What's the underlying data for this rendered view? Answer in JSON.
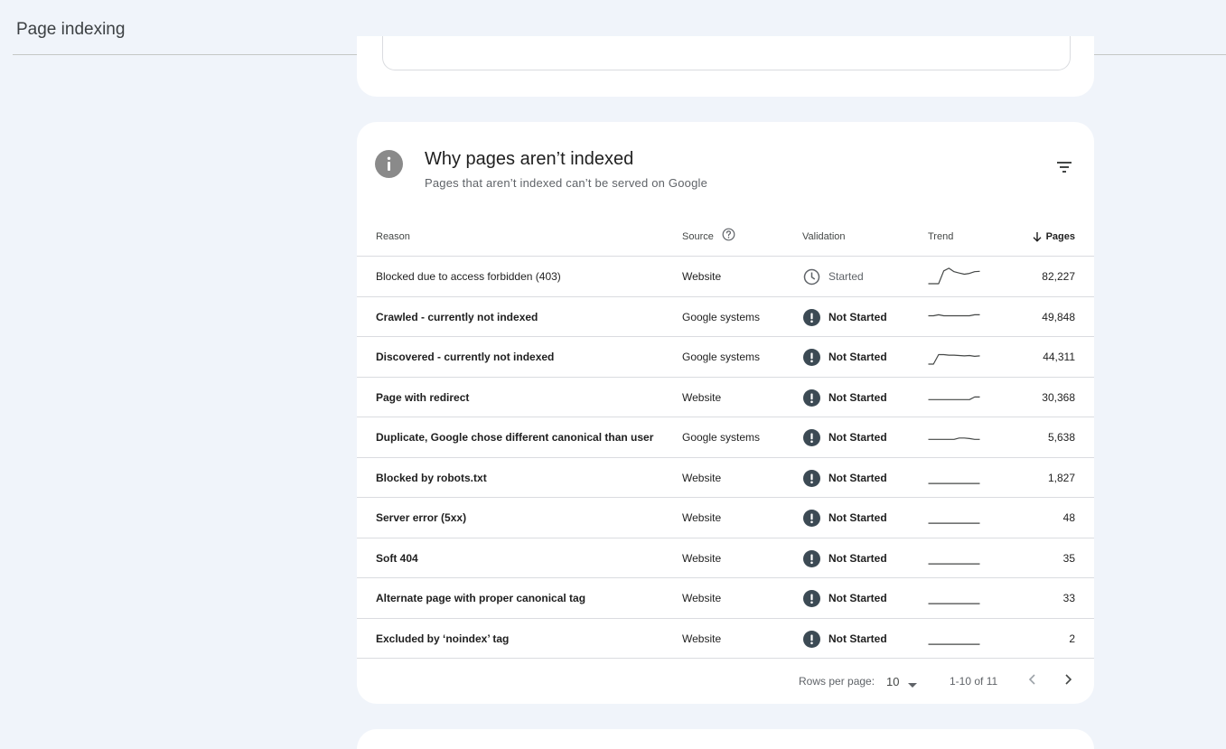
{
  "header": {
    "title": "Page indexing"
  },
  "card": {
    "title": "Why pages aren’t indexed",
    "subtitle": "Pages that aren’t indexed can’t be served on Google",
    "icon": "info-icon",
    "filter_icon": "filter-icon"
  },
  "table": {
    "columns": {
      "reason": "Reason",
      "source": "Source",
      "validation": "Validation",
      "trend": "Trend",
      "pages": "Pages"
    },
    "sort": {
      "column": "pages",
      "direction": "descending"
    },
    "rows": [
      {
        "reason": "Blocked due to access forbidden (403)",
        "source": "Website",
        "validation": "Started",
        "validation_icon": "clock-icon",
        "trend": [
          0,
          0,
          0,
          0.75,
          0.9,
          0.7,
          0.62,
          0.55,
          0.6,
          0.7,
          0.72
        ],
        "pages": "82,227"
      },
      {
        "reason": "Crawled - currently not indexed",
        "source": "Google systems",
        "validation": "Not Started",
        "validation_icon": "exclamation-icon",
        "trend": [
          0.5,
          0.5,
          0.56,
          0.5,
          0.5,
          0.5,
          0.5,
          0.5,
          0.5,
          0.56,
          0.56
        ],
        "pages": "49,848"
      },
      {
        "reason": "Discovered - currently not indexed",
        "source": "Google systems",
        "validation": "Not Started",
        "validation_icon": "exclamation-icon",
        "trend": [
          0,
          0,
          0.55,
          0.55,
          0.52,
          0.52,
          0.5,
          0.48,
          0.5,
          0.45,
          0.48
        ],
        "pages": "44,311"
      },
      {
        "reason": "Page with redirect",
        "source": "Website",
        "validation": "Not Started",
        "validation_icon": "exclamation-icon",
        "trend": [
          0.3,
          0.3,
          0.3,
          0.3,
          0.3,
          0.3,
          0.3,
          0.3,
          0.3,
          0.45,
          0.45
        ],
        "pages": "30,368"
      },
      {
        "reason": "Duplicate, Google chose different canonical than user",
        "source": "Google systems",
        "validation": "Not Started",
        "validation_icon": "exclamation-icon",
        "trend": [
          0.3,
          0.3,
          0.3,
          0.3,
          0.3,
          0.3,
          0.38,
          0.38,
          0.35,
          0.3,
          0.3
        ],
        "pages": "5,638"
      },
      {
        "reason": "Blocked by robots.txt",
        "source": "Website",
        "validation": "Not Started",
        "validation_icon": "exclamation-icon",
        "trend": [
          0.1,
          0.1,
          0.1,
          0.1,
          0.1,
          0.1,
          0.1,
          0.1,
          0.1,
          0.1,
          0.1
        ],
        "pages": "1,827"
      },
      {
        "reason": "Server error (5xx)",
        "source": "Website",
        "validation": "Not Started",
        "validation_icon": "exclamation-icon",
        "trend": [
          0.1,
          0.1,
          0.1,
          0.1,
          0.1,
          0.1,
          0.1,
          0.1,
          0.1,
          0.1,
          0.1
        ],
        "pages": "48"
      },
      {
        "reason": "Soft 404",
        "source": "Website",
        "validation": "Not Started",
        "validation_icon": "exclamation-icon",
        "trend": [
          0.1,
          0.1,
          0.1,
          0.1,
          0.1,
          0.1,
          0.1,
          0.1,
          0.1,
          0.1,
          0.1
        ],
        "pages": "35"
      },
      {
        "reason": "Alternate page with proper canonical tag",
        "source": "Website",
        "validation": "Not Started",
        "validation_icon": "exclamation-icon",
        "trend": [
          0.1,
          0.1,
          0.1,
          0.1,
          0.1,
          0.1,
          0.1,
          0.1,
          0.1,
          0.1,
          0.1
        ],
        "pages": "33"
      },
      {
        "reason": "Excluded by ‘noindex’ tag",
        "source": "Website",
        "validation": "Not Started",
        "validation_icon": "exclamation-icon",
        "trend": [
          0.1,
          0.1,
          0.1,
          0.1,
          0.1,
          0.1,
          0.1,
          0.1,
          0.1,
          0.1,
          0.1
        ],
        "pages": "2"
      }
    ]
  },
  "pagination": {
    "rows_per_page_label": "Rows per page:",
    "rows_per_page_value": "10",
    "range": "1-10 of 11"
  },
  "colors": {
    "background": "#f0f4fa",
    "card": "#ffffff",
    "status_icon": "#3c4a54",
    "trend_line": "#444746",
    "divider": "#dadce0"
  }
}
